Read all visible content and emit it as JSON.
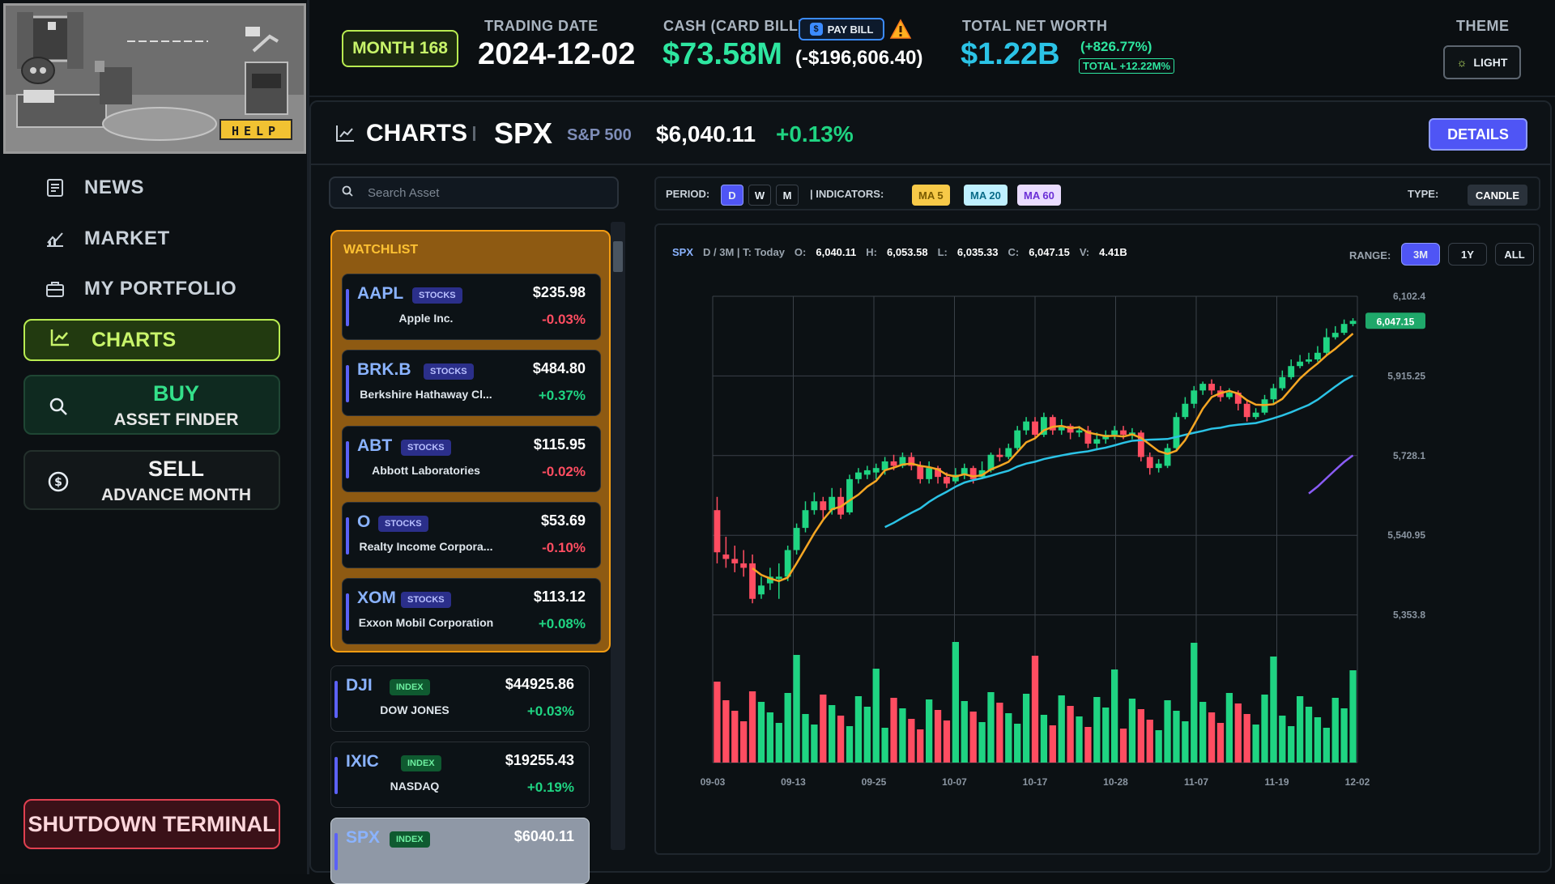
{
  "sidebar": {
    "help_label": "HELP",
    "nav": [
      {
        "label": "NEWS",
        "icon": "newspaper-icon"
      },
      {
        "label": "MARKET",
        "icon": "trend-chart-icon"
      },
      {
        "label": "MY PORTFOLIO",
        "icon": "briefcase-icon"
      }
    ],
    "charts_label": "CHARTS",
    "buy": {
      "title": "BUY",
      "subtitle": "ASSET FINDER"
    },
    "sell": {
      "title": "SELL",
      "subtitle": "ADVANCE MONTH"
    },
    "shutdown_label": "SHUTDOWN TERMINAL"
  },
  "topbar": {
    "month_label": "MONTH 168",
    "trading_date_label": "TRADING DATE",
    "trading_date": "2024-12-02",
    "cash_label": "CASH (CARD BILL)",
    "pay_bill_label": "PAY BILL",
    "cash_value": "$73.58M",
    "card_bill": "(-$196,606.40)",
    "net_worth_label": "TOTAL NET WORTH",
    "net_worth_value": "$1.22B",
    "net_worth_change": "(+826.77%)",
    "net_worth_total": "TOTAL +12.22M%",
    "theme_label": "THEME",
    "theme_button": "LIGHT"
  },
  "panel": {
    "title": "CHARTS",
    "symbol": "SPX",
    "symbol_name": "S&P 500",
    "price": "$6,040.11",
    "change": "+0.13%",
    "details_label": "DETAILS"
  },
  "asset_list": {
    "search_placeholder": "Search Asset",
    "watchlist_title": "WATCHLIST",
    "watchlist": [
      {
        "symbol": "AAPL",
        "tag": "STOCKS",
        "name": "Apple Inc.",
        "price": "$235.98",
        "change": "-0.03%",
        "dir": "down"
      },
      {
        "symbol": "BRK.B",
        "tag": "STOCKS",
        "name": "Berkshire Hathaway Cl...",
        "price": "$484.80",
        "change": "+0.37%",
        "dir": "up"
      },
      {
        "symbol": "ABT",
        "tag": "STOCKS",
        "name": "Abbott Laboratories",
        "price": "$115.95",
        "change": "-0.02%",
        "dir": "down"
      },
      {
        "symbol": "O",
        "tag": "STOCKS",
        "name": "Realty Income Corpora...",
        "price": "$53.69",
        "change": "-0.10%",
        "dir": "down"
      },
      {
        "symbol": "XOM",
        "tag": "STOCKS",
        "name": "Exxon Mobil Corporation",
        "price": "$113.12",
        "change": "+0.08%",
        "dir": "up"
      }
    ],
    "others": [
      {
        "symbol": "DJI",
        "tag": "INDEX",
        "name": "DOW JONES",
        "price": "$44925.86",
        "change": "+0.03%",
        "dir": "up"
      },
      {
        "symbol": "IXIC",
        "tag": "INDEX",
        "name": "NASDAQ",
        "price": "$19255.43",
        "change": "+0.19%",
        "dir": "up"
      },
      {
        "symbol": "SPX",
        "tag": "INDEX",
        "name": "",
        "price": "$6040.11",
        "change": "",
        "dir": "up"
      }
    ]
  },
  "toolbar": {
    "period_label": "PERIOD:",
    "periods": [
      "D",
      "W",
      "M"
    ],
    "active_period": "D",
    "indicators_label": "| INDICATORS:",
    "ma": [
      {
        "label": "MA 5",
        "bg": "#f7c948",
        "fg": "#7a5a00"
      },
      {
        "label": "MA 20",
        "bg": "#bff0ff",
        "fg": "#0a6b88"
      },
      {
        "label": "MA 60",
        "bg": "#e9dcff",
        "fg": "#6b2fd6"
      }
    ],
    "type_label": "TYPE:",
    "type_value": "CANDLE"
  },
  "ohlc": {
    "symbol": "SPX",
    "meta": "D / 3M | T: Today",
    "o_label": "O:",
    "o": "6,040.11",
    "h_label": "H:",
    "h": "6,053.58",
    "l_label": "L:",
    "l": "6,035.33",
    "c_label": "C:",
    "c": "6,047.15",
    "v_label": "V:",
    "v": "4.41B",
    "range_label": "RANGE:",
    "ranges": [
      "3M",
      "1Y",
      "ALL"
    ],
    "active_range": "3M"
  },
  "colors": {
    "up": "#1fd482",
    "down": "#ff4d61",
    "ma5": "#f5a623",
    "ma20": "#2bc3e6",
    "ma60": "#8a5cf6",
    "accent": "#4f55f5",
    "lime": "#b9ec51"
  },
  "chart_data": {
    "type": "candlestick",
    "y_ticks": [
      "6,102.4",
      "5,915.25",
      "5,728.1",
      "5,540.95",
      "5,353.8"
    ],
    "x_ticks": [
      "09-03",
      "09-13",
      "09-25",
      "10-07",
      "10-17",
      "10-28",
      "11-07",
      "11-19",
      "12-02"
    ],
    "ylim": [
      5353.8,
      6102.4
    ],
    "last_price_label": "6,047.15",
    "last_price": 6047.15,
    "candles": [
      [
        5620,
        5525,
        5650,
        5500
      ],
      [
        5520,
        5510,
        5560,
        5490
      ],
      [
        5510,
        5500,
        5540,
        5480
      ],
      [
        5500,
        5490,
        5530,
        5470
      ],
      [
        5500,
        5420,
        5520,
        5410
      ],
      [
        5430,
        5450,
        5470,
        5420
      ],
      [
        5455,
        5470,
        5490,
        5440
      ],
      [
        5465,
        5470,
        5500,
        5420
      ],
      [
        5470,
        5530,
        5540,
        5460
      ],
      [
        5530,
        5580,
        5590,
        5520
      ],
      [
        5580,
        5620,
        5640,
        5570
      ],
      [
        5620,
        5640,
        5660,
        5610
      ],
      [
        5640,
        5620,
        5650,
        5600
      ],
      [
        5620,
        5650,
        5670,
        5610
      ],
      [
        5650,
        5610,
        5670,
        5600
      ],
      [
        5615,
        5690,
        5700,
        5610
      ],
      [
        5690,
        5705,
        5715,
        5680
      ],
      [
        5700,
        5710,
        5720,
        5690
      ],
      [
        5705,
        5715,
        5725,
        5690
      ],
      [
        5710,
        5730,
        5740,
        5700
      ],
      [
        5730,
        5720,
        5745,
        5710
      ],
      [
        5720,
        5740,
        5750,
        5715
      ],
      [
        5740,
        5720,
        5750,
        5710
      ],
      [
        5720,
        5690,
        5730,
        5680
      ],
      [
        5690,
        5715,
        5730,
        5680
      ],
      [
        5715,
        5695,
        5720,
        5680
      ],
      [
        5695,
        5680,
        5705,
        5670
      ],
      [
        5685,
        5700,
        5715,
        5680
      ],
      [
        5700,
        5715,
        5725,
        5690
      ],
      [
        5715,
        5690,
        5720,
        5680
      ],
      [
        5695,
        5710,
        5730,
        5690
      ],
      [
        5710,
        5745,
        5750,
        5705
      ],
      [
        5745,
        5740,
        5760,
        5730
      ],
      [
        5740,
        5760,
        5770,
        5735
      ],
      [
        5760,
        5800,
        5810,
        5755
      ],
      [
        5800,
        5820,
        5830,
        5790
      ],
      [
        5820,
        5790,
        5830,
        5780
      ],
      [
        5790,
        5830,
        5840,
        5785
      ],
      [
        5830,
        5800,
        5835,
        5790
      ],
      [
        5800,
        5810,
        5825,
        5790
      ],
      [
        5810,
        5795,
        5815,
        5780
      ],
      [
        5795,
        5800,
        5810,
        5785
      ],
      [
        5800,
        5770,
        5810,
        5760
      ],
      [
        5770,
        5780,
        5795,
        5755
      ],
      [
        5780,
        5790,
        5800,
        5770
      ],
      [
        5790,
        5800,
        5810,
        5780
      ],
      [
        5800,
        5790,
        5810,
        5780
      ],
      [
        5790,
        5795,
        5805,
        5780
      ],
      [
        5795,
        5740,
        5800,
        5730
      ],
      [
        5740,
        5715,
        5750,
        5700
      ],
      [
        5715,
        5725,
        5735,
        5705
      ],
      [
        5720,
        5760,
        5770,
        5715
      ],
      [
        5760,
        5830,
        5840,
        5755
      ],
      [
        5830,
        5860,
        5875,
        5825
      ],
      [
        5860,
        5890,
        5900,
        5850
      ],
      [
        5890,
        5905,
        5910,
        5880
      ],
      [
        5905,
        5890,
        5915,
        5880
      ],
      [
        5890,
        5875,
        5900,
        5865
      ],
      [
        5875,
        5885,
        5895,
        5870
      ],
      [
        5885,
        5860,
        5890,
        5845
      ],
      [
        5860,
        5830,
        5870,
        5820
      ],
      [
        5830,
        5840,
        5850,
        5825
      ],
      [
        5840,
        5870,
        5880,
        5835
      ],
      [
        5870,
        5895,
        5905,
        5860
      ],
      [
        5895,
        5920,
        5935,
        5890
      ],
      [
        5920,
        5945,
        5960,
        5915
      ],
      [
        5945,
        5955,
        5970,
        5940
      ],
      [
        5955,
        5960,
        5975,
        5950
      ],
      [
        5960,
        5975,
        5990,
        5955
      ],
      [
        5975,
        6010,
        6030,
        5970
      ],
      [
        6010,
        6020,
        6035,
        6005
      ],
      [
        6020,
        6040,
        6050,
        6015
      ],
      [
        6040,
        6047,
        6053,
        6035
      ]
    ]
  }
}
